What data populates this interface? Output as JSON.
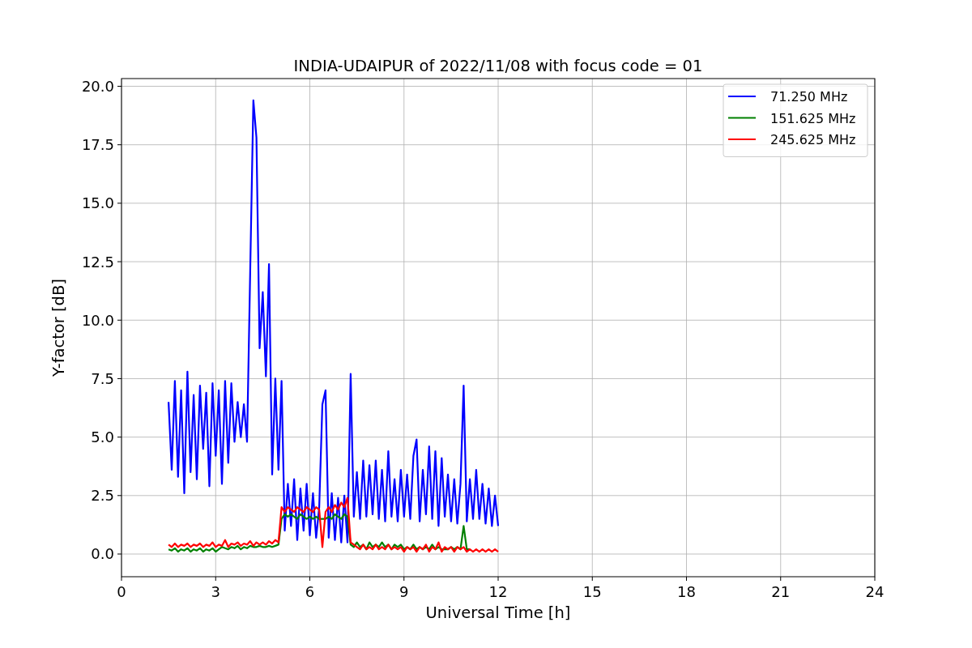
{
  "chart_data": {
    "type": "line",
    "title": "INDIA-UDAIPUR of 2022/11/08 with focus code = 01",
    "xlabel": "Universal Time [h]",
    "ylabel": "Y-factor [dB]",
    "x": [
      1.5,
      1.6,
      1.7,
      1.8,
      1.9,
      2.0,
      2.1,
      2.2,
      2.3,
      2.4,
      2.5,
      2.6,
      2.7,
      2.8,
      2.9,
      3.0,
      3.1,
      3.2,
      3.3,
      3.4,
      3.5,
      3.6,
      3.7,
      3.8,
      3.9,
      4.0,
      4.1,
      4.2,
      4.3,
      4.4,
      4.5,
      4.6,
      4.7,
      4.8,
      4.9,
      5.0,
      5.1,
      5.2,
      5.3,
      5.4,
      5.5,
      5.6,
      5.7,
      5.8,
      5.9,
      6.0,
      6.1,
      6.2,
      6.3,
      6.4,
      6.5,
      6.6,
      6.7,
      6.8,
      6.9,
      7.0,
      7.1,
      7.2,
      7.3,
      7.4,
      7.5,
      7.6,
      7.7,
      7.8,
      7.9,
      8.0,
      8.1,
      8.2,
      8.3,
      8.4,
      8.5,
      8.6,
      8.7,
      8.8,
      8.9,
      9.0,
      9.1,
      9.2,
      9.3,
      9.4,
      9.5,
      9.6,
      9.7,
      9.8,
      9.9,
      10.0,
      10.1,
      10.2,
      10.3,
      10.4,
      10.5,
      10.6,
      10.7,
      10.8,
      10.9,
      11.0,
      11.1,
      11.2,
      11.3,
      11.4,
      11.5,
      11.6,
      11.7,
      11.8,
      11.9,
      12.0
    ],
    "series": [
      {
        "name": "71.250 MHz",
        "color": "#0000ff",
        "values": [
          6.5,
          3.6,
          7.4,
          3.3,
          7.0,
          2.6,
          7.8,
          3.5,
          6.8,
          3.2,
          7.2,
          4.5,
          6.9,
          2.9,
          7.3,
          4.2,
          7.0,
          3.0,
          7.4,
          3.9,
          7.3,
          4.8,
          6.5,
          5.0,
          6.4,
          4.8,
          12.1,
          19.4,
          17.8,
          8.8,
          11.2,
          7.6,
          12.4,
          3.4,
          7.5,
          3.6,
          7.4,
          1.0,
          3.0,
          1.2,
          3.2,
          0.6,
          2.8,
          1.0,
          3.0,
          0.8,
          2.6,
          0.7,
          2.0,
          6.4,
          7.0,
          0.7,
          2.6,
          0.6,
          2.4,
          0.5,
          2.5,
          0.5,
          7.7,
          1.6,
          3.5,
          1.5,
          4.0,
          1.6,
          3.8,
          1.7,
          4.0,
          1.5,
          3.6,
          1.4,
          4.4,
          1.6,
          3.2,
          1.4,
          3.6,
          1.6,
          3.4,
          1.5,
          4.2,
          4.9,
          1.4,
          3.6,
          1.7,
          4.6,
          1.5,
          4.4,
          1.2,
          4.1,
          1.6,
          3.4,
          1.4,
          3.2,
          1.3,
          3.0,
          7.2,
          1.4,
          3.2,
          1.5,
          3.6,
          1.5,
          3.0,
          1.3,
          2.8,
          1.2,
          2.5,
          1.2
        ]
      },
      {
        "name": "151.625 MHz",
        "color": "#008000",
        "values": [
          0.2,
          0.15,
          0.25,
          0.1,
          0.2,
          0.15,
          0.25,
          0.1,
          0.2,
          0.15,
          0.25,
          0.1,
          0.2,
          0.15,
          0.25,
          0.1,
          0.2,
          0.3,
          0.25,
          0.2,
          0.3,
          0.25,
          0.35,
          0.2,
          0.3,
          0.25,
          0.35,
          0.3,
          0.3,
          0.35,
          0.3,
          0.3,
          0.35,
          0.3,
          0.35,
          0.4,
          1.5,
          1.7,
          1.6,
          1.7,
          1.6,
          1.5,
          1.7,
          1.6,
          1.5,
          1.6,
          1.5,
          1.6,
          1.5,
          null,
          1.5,
          1.6,
          1.5,
          1.7,
          1.6,
          1.5,
          1.7,
          1.6,
          0.4,
          0.3,
          0.5,
          0.3,
          0.4,
          0.2,
          0.5,
          0.3,
          0.4,
          0.3,
          0.5,
          0.3,
          0.4,
          0.2,
          0.4,
          0.3,
          0.4,
          0.2,
          0.3,
          0.2,
          0.4,
          0.2,
          0.3,
          0.2,
          0.3,
          0.2,
          0.4,
          0.2,
          0.3,
          0.2,
          null,
          0.2,
          0.3,
          0.2,
          0.3,
          0.2,
          1.2,
          0.2,
          0.2,
          null,
          null,
          null,
          null,
          null,
          null,
          null,
          null,
          null
        ]
      },
      {
        "name": "245.625 MHz",
        "color": "#ff0000",
        "values": [
          0.4,
          0.3,
          0.45,
          0.3,
          0.4,
          0.35,
          0.45,
          0.3,
          0.4,
          0.35,
          0.45,
          0.3,
          0.4,
          0.35,
          0.5,
          0.3,
          0.4,
          0.35,
          0.6,
          0.3,
          0.45,
          0.4,
          0.5,
          0.35,
          0.45,
          0.4,
          0.55,
          0.35,
          0.5,
          0.4,
          0.5,
          0.4,
          0.55,
          0.45,
          0.6,
          0.5,
          2.0,
          1.8,
          2.0,
          1.9,
          1.8,
          2.0,
          1.9,
          1.8,
          2.0,
          1.9,
          1.8,
          2.0,
          1.9,
          0.3,
          1.8,
          2.0,
          1.8,
          2.1,
          1.9,
          2.2,
          2.0,
          2.4,
          0.5,
          0.4,
          0.3,
          0.2,
          0.4,
          0.2,
          0.3,
          0.2,
          0.4,
          0.2,
          0.3,
          0.2,
          0.4,
          0.2,
          0.3,
          0.2,
          0.3,
          0.1,
          0.3,
          0.2,
          0.3,
          0.1,
          0.3,
          0.2,
          0.4,
          0.1,
          0.3,
          0.2,
          0.5,
          0.1,
          0.3,
          0.2,
          0.3,
          0.1,
          0.3,
          0.2,
          0.3,
          0.1,
          0.2,
          0.1,
          0.2,
          0.1,
          0.2,
          0.1,
          0.2,
          0.1,
          0.2,
          0.1
        ]
      }
    ],
    "grid": true,
    "legend": true,
    "xlim": [
      0,
      24
    ],
    "ylim": [
      -0.97,
      20.33
    ],
    "xticks": [
      0,
      3,
      6,
      9,
      12,
      15,
      18,
      21,
      24
    ],
    "yticks": [
      {
        "value": 0,
        "label": "0.0"
      },
      {
        "value": 2.5,
        "label": "2.5"
      },
      {
        "value": 5,
        "label": "5.0"
      },
      {
        "value": 7.5,
        "label": "7.5"
      },
      {
        "value": 10,
        "label": "10.0"
      },
      {
        "value": 12.5,
        "label": "12.5"
      },
      {
        "value": 15,
        "label": "15.0"
      },
      {
        "value": 17.5,
        "label": "17.5"
      },
      {
        "value": 20,
        "label": "20.0"
      }
    ]
  }
}
